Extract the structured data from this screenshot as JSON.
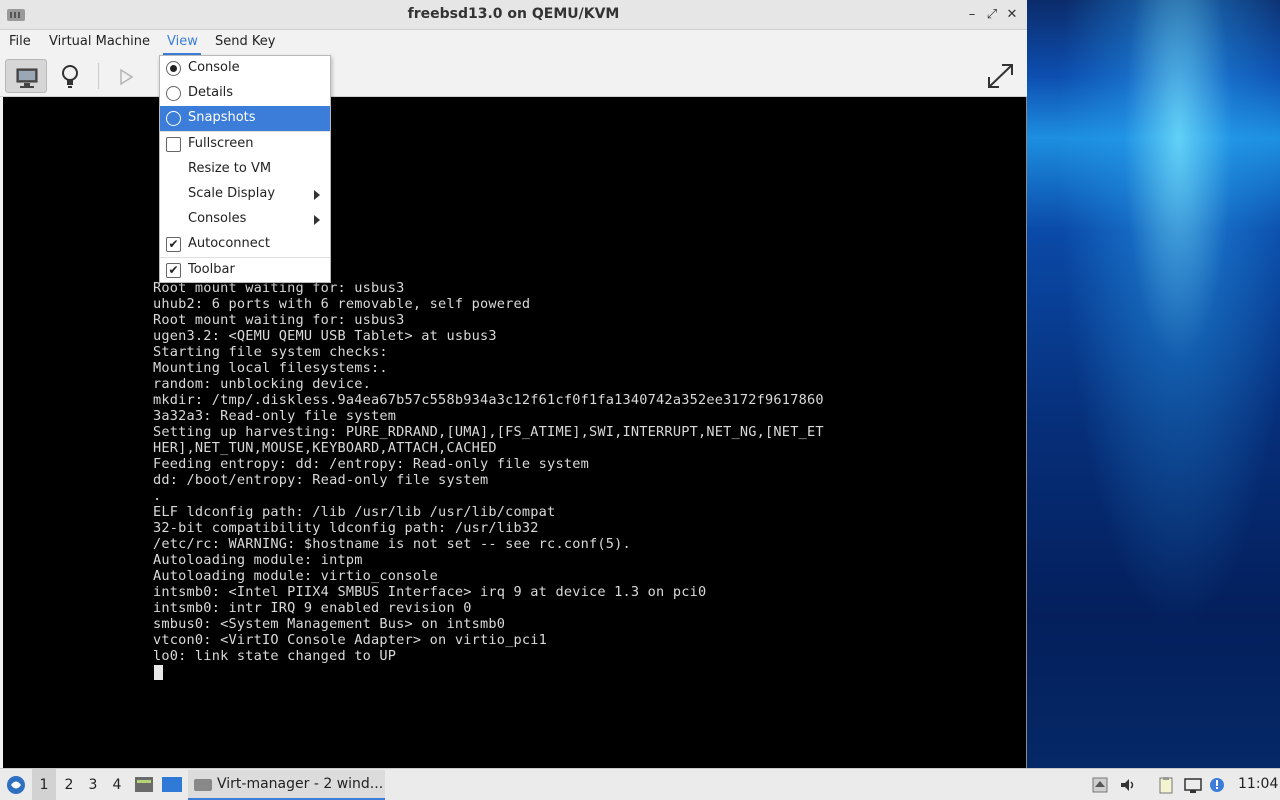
{
  "window": {
    "title": "freebsd13.0 on QEMU/KVM",
    "controls": {
      "minimize": "–",
      "maximize": "⤢",
      "close": "✕"
    }
  },
  "menubar": {
    "items": [
      "File",
      "Virtual Machine",
      "View",
      "Send Key"
    ],
    "active": "View"
  },
  "toolbar": {
    "icons": [
      "console-monitor-icon",
      "details-bulb-icon",
      "run-play-icon",
      "fullscreen-expand-icon"
    ]
  },
  "view_menu": {
    "items": [
      {
        "label": "Console",
        "kind": "radio",
        "checked": true
      },
      {
        "label": "Details",
        "kind": "radio",
        "checked": false
      },
      {
        "label": "Snapshots",
        "kind": "radio",
        "checked": false,
        "highlighted": true
      },
      {
        "label": "Fullscreen",
        "kind": "check",
        "checked": false
      },
      {
        "label": "Resize to VM",
        "kind": "plain"
      },
      {
        "label": "Scale Display",
        "kind": "submenu"
      },
      {
        "label": "Consoles",
        "kind": "submenu"
      },
      {
        "label": "Autoconnect",
        "kind": "check",
        "checked": true
      },
      {
        "label": "Toolbar",
        "kind": "check",
        "checked": true
      }
    ]
  },
  "console": {
    "lines": [
      "Root mount waiting for: usbus3",
      "uhub2: 6 ports with 6 removable, self powered",
      "Root mount waiting for: usbus3",
      "ugen3.2: <QEMU QEMU USB Tablet> at usbus3",
      "Starting file system checks:",
      "Mounting local filesystems:.",
      "random: unblocking device.",
      "mkdir: /tmp/.diskless.9a4ea67b57c558b934a3c12f61cf0f1fa1340742a352ee3172f9617860",
      "3a32a3: Read-only file system",
      "Setting up harvesting: PURE_RDRAND,[UMA],[FS_ATIME],SWI,INTERRUPT,NET_NG,[NET_ET",
      "HER],NET_TUN,MOUSE,KEYBOARD,ATTACH,CACHED",
      "Feeding entropy: dd: /entropy: Read-only file system",
      "dd: /boot/entropy: Read-only file system",
      ".",
      "ELF ldconfig path: /lib /usr/lib /usr/lib/compat",
      "32-bit compatibility ldconfig path: /usr/lib32",
      "/etc/rc: WARNING: $hostname is not set -- see rc.conf(5).",
      "Autoloading module: intpm",
      "Autoloading module: virtio_console",
      "intsmb0: <Intel PIIX4 SMBUS Interface> irq 9 at device 1.3 on pci0",
      "intsmb0: intr IRQ 9 enabled revision 0",
      "smbus0: <System Management Bus> on intsmb0",
      "vtcon0: <VirtIO Console Adapter> on virtio_pci1",
      "lo0: link state changed to UP"
    ]
  },
  "taskbar": {
    "workspaces": [
      "1",
      "2",
      "3",
      "4"
    ],
    "active_workspace": "1",
    "task_label": "Virt-manager - 2 wind...",
    "clock": "11:04"
  },
  "colors": {
    "accent": "#3b7dd8",
    "console_bg": "#000000",
    "console_fg": "#d9d9d9"
  }
}
